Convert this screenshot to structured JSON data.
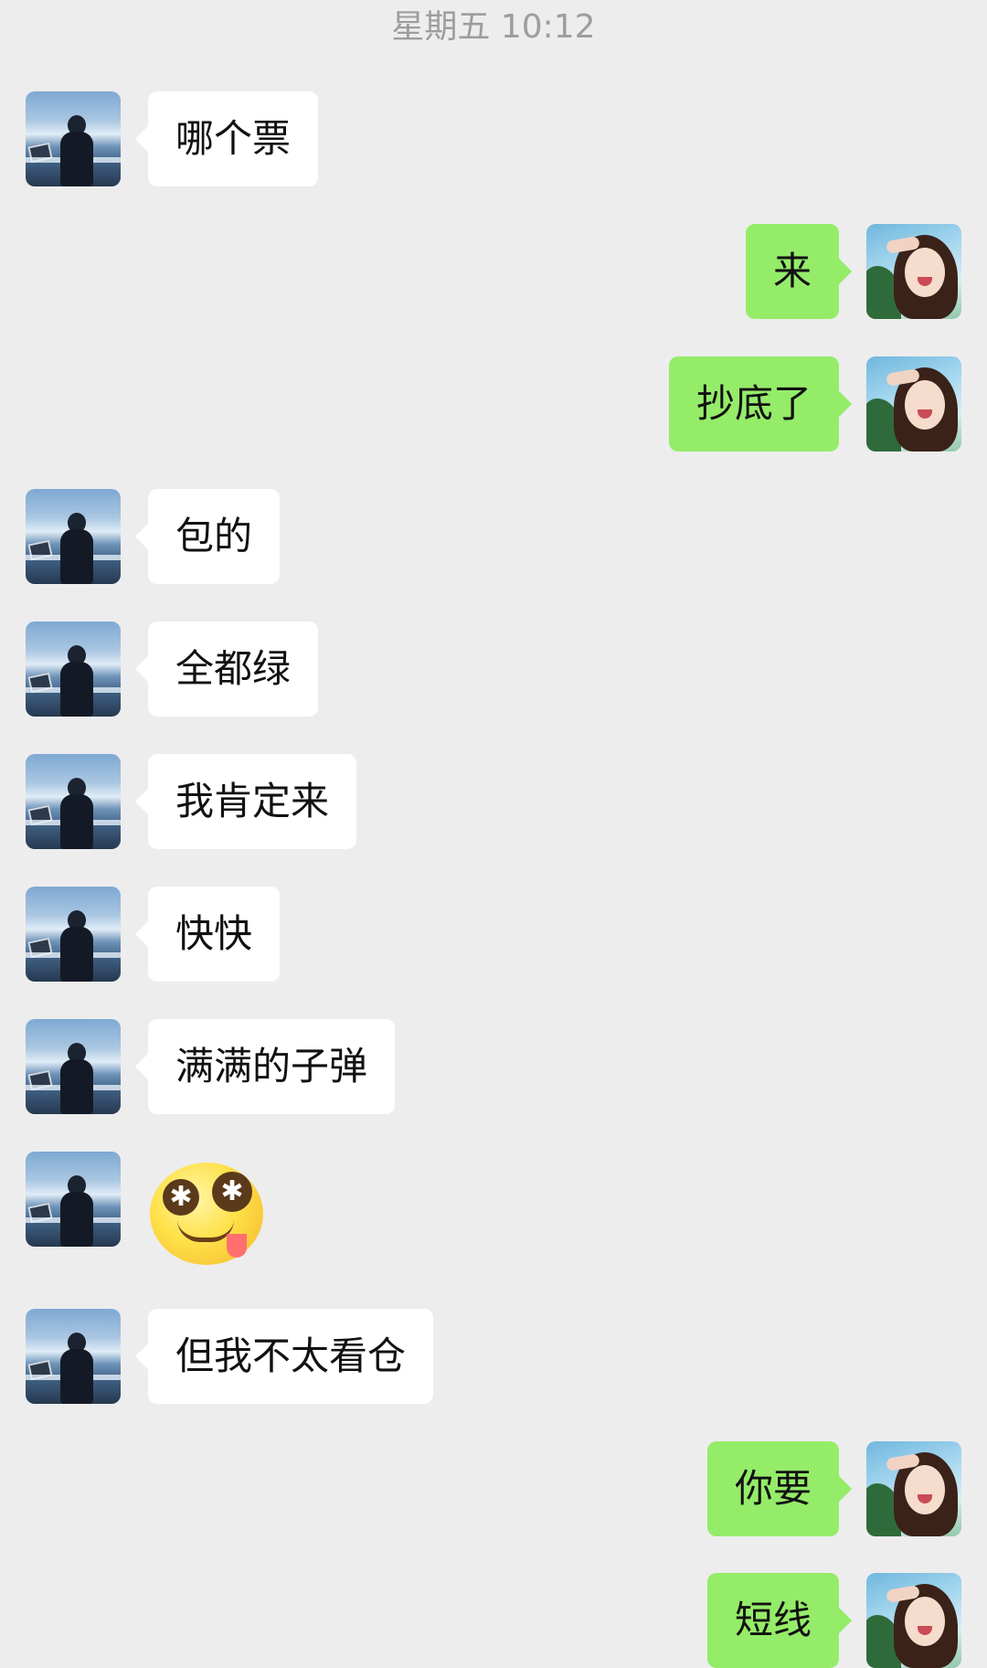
{
  "chat": {
    "timestamp": "星期五 10:12",
    "messages": [
      {
        "side": "left",
        "type": "text",
        "text": "哪个票"
      },
      {
        "side": "right",
        "type": "text",
        "text": "来"
      },
      {
        "side": "right",
        "type": "text",
        "text": "抄底了"
      },
      {
        "side": "left",
        "type": "text",
        "text": "包的"
      },
      {
        "side": "left",
        "type": "text",
        "text": "全都绿"
      },
      {
        "side": "left",
        "type": "text",
        "text": "我肯定来"
      },
      {
        "side": "left",
        "type": "text",
        "text": "快快"
      },
      {
        "side": "left",
        "type": "text",
        "text": "满满的子弹"
      },
      {
        "side": "left",
        "type": "sticker",
        "icon": "dizzy-eyes-tongue-sticker",
        "text": ""
      },
      {
        "side": "left",
        "type": "text",
        "text": "但我不太看仓"
      },
      {
        "side": "right",
        "type": "text",
        "text": "你要"
      },
      {
        "side": "right",
        "type": "text",
        "text": "短线"
      }
    ]
  },
  "colors": {
    "background": "#ededed",
    "incoming_bubble": "#ffffff",
    "outgoing_bubble": "#95ec69",
    "timestamp_text": "#9d9d9d"
  }
}
